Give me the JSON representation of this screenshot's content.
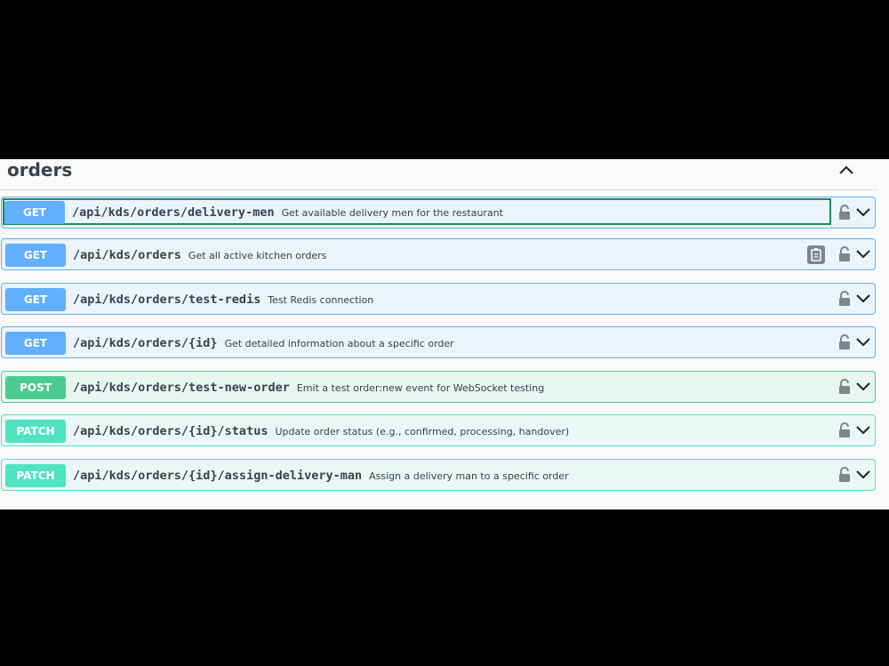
{
  "section": {
    "title": "orders",
    "collapse_icon": "chevron-up-icon"
  },
  "operations": [
    {
      "method": "GET",
      "path": "/api/kds/orders/delivery-men",
      "summary": "Get available delivery men for the restaurant"
    },
    {
      "method": "GET",
      "path": "/api/kds/orders",
      "summary": "Get all active kitchen orders"
    },
    {
      "method": "GET",
      "path": "/api/kds/orders/test-redis",
      "summary": "Test Redis connection"
    },
    {
      "method": "GET",
      "path": "/api/kds/orders/{id}",
      "summary": "Get detailed information about a specific order"
    },
    {
      "method": "POST",
      "path": "/api/kds/orders/test-new-order",
      "summary": "Emit a test order:new event for WebSocket testing"
    },
    {
      "method": "PATCH",
      "path": "/api/kds/orders/{id}/status",
      "summary": "Update order status (e.g., confirmed, processing, handover)"
    },
    {
      "method": "PATCH",
      "path": "/api/kds/orders/{id}/assign-delivery-man",
      "summary": "Assign a delivery man to a specific order"
    }
  ],
  "colors": {
    "get": "#61affe",
    "post": "#49cc90",
    "patch": "#50e3c2",
    "text": "#3b4151"
  }
}
